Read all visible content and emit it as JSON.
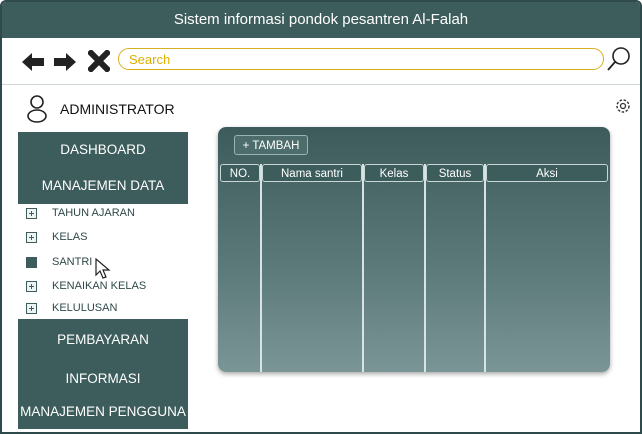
{
  "window": {
    "title": "Sistem informasi pondok pesantren Al-Falah"
  },
  "toolbar": {
    "back_icon": "arrow-left-icon",
    "forward_icon": "arrow-right-icon",
    "close_icon": "close-icon",
    "search_placeholder": "Search",
    "search_icon": "search-icon"
  },
  "user": {
    "role": "ADMINISTRATOR",
    "icon": "user-icon",
    "settings_icon": "gear-icon"
  },
  "sidebar": {
    "dashboard": "DASHBOARD",
    "manajemen_data": "MANAJEMEN DATA",
    "subitems": [
      {
        "label": "TAHUN AJARAN",
        "icon": "plus-box-icon"
      },
      {
        "label": "KELAS",
        "icon": "plus-box-icon"
      },
      {
        "label": "SANTRI",
        "icon": "filled-box-icon"
      },
      {
        "label": "KENAIKAN KELAS",
        "icon": "plus-box-icon"
      },
      {
        "label": "KELULUSAN",
        "icon": "plus-box-icon"
      }
    ],
    "pembayaran": "PEMBAYARAN",
    "informasi": "INFORMASI",
    "manajemen_pengguna": "MANAJEMEN PENGGUNA"
  },
  "main": {
    "add_button": "+ TAMBAH",
    "columns": [
      "NO.",
      "Nama santri",
      "Kelas",
      "Status",
      "Aksi"
    ]
  },
  "colors": {
    "primary": "#3d5c5c",
    "search_border": "#d6b020",
    "search_text": "#e0b000"
  }
}
